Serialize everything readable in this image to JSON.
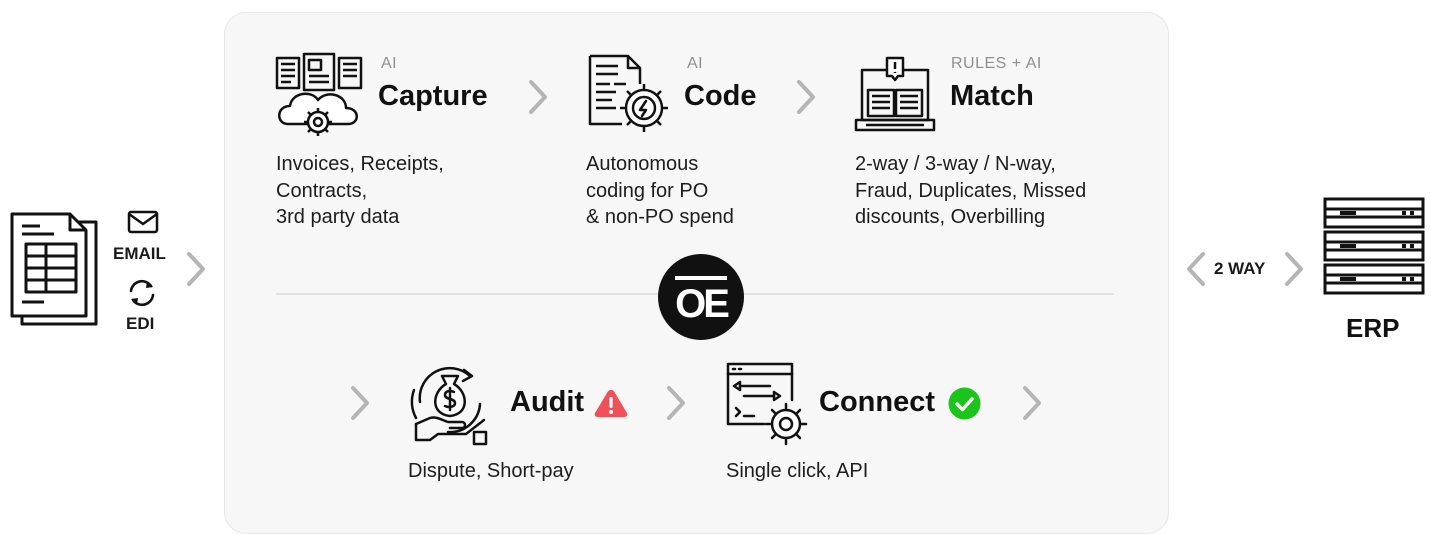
{
  "steps": {
    "capture": {
      "tag": "AI",
      "title": "Capture",
      "desc": [
        "Invoices, Receipts,",
        "Contracts,",
        "3rd party data"
      ],
      "icon": "cloud-documents-gear-icon"
    },
    "code": {
      "tag": "AI",
      "title": "Code",
      "desc": [
        "Autonomous",
        "coding for PO",
        "& non-PO spend"
      ],
      "icon": "document-gear-icon"
    },
    "match": {
      "tag": "RULES + AI",
      "title": "Match",
      "desc": [
        "2-way / 3-way / N-way,",
        "Fraud, Duplicates, Missed",
        "discounts, Overbilling"
      ],
      "icon": "laptop-alert-book-icon"
    },
    "audit": {
      "title": "Audit",
      "desc": "Dispute, Short-pay",
      "icon": "money-bag-hand-icon",
      "status_icon": "warning-icon",
      "status_color": "#f0505a"
    },
    "connect": {
      "title": "Connect",
      "desc": "Single click, API",
      "icon": "code-window-gear-icon",
      "status_icon": "checkmark-icon",
      "status_color": "#1bc41b"
    }
  },
  "inputs": {
    "email_label": "EMAIL",
    "edi_label": "EDI"
  },
  "logo": {
    "text": "OE"
  },
  "sync": {
    "label": "2 WAY"
  },
  "erp": {
    "label": "ERP",
    "icon": "server-rack-icon"
  },
  "colors": {
    "panel_bg": "#f7f7f7",
    "chevron": "#b5b5b5",
    "tag": "#8f8f8f",
    "logo_bg": "#111111"
  }
}
